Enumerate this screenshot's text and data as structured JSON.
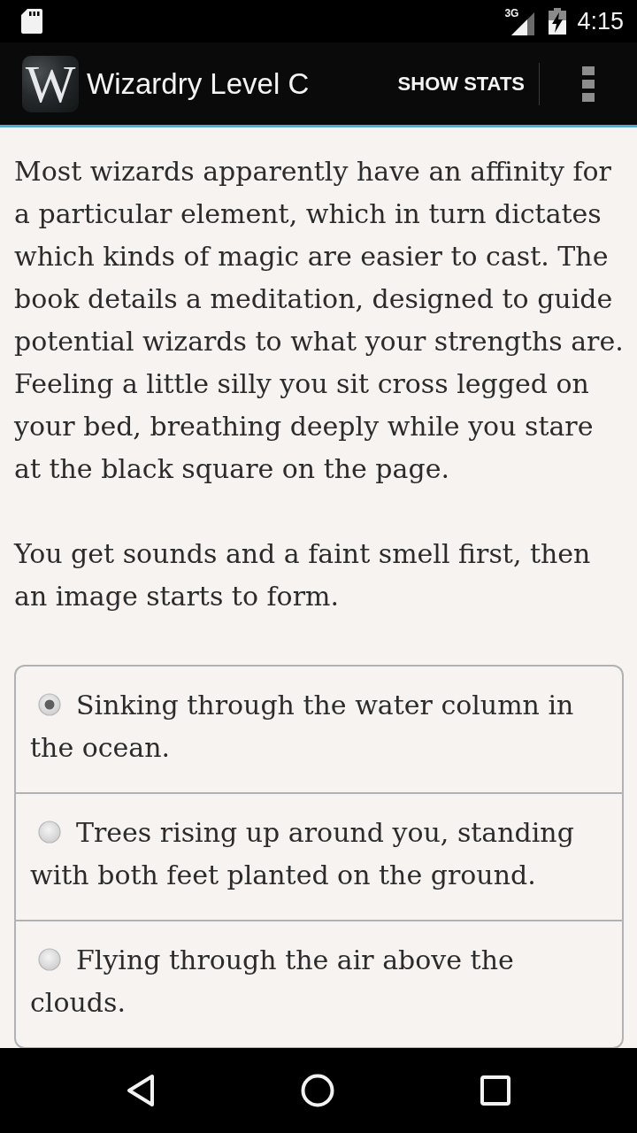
{
  "status_bar": {
    "network": "3G",
    "time": "4:15"
  },
  "app_bar": {
    "logo_letter": "W",
    "title": "Wizardry Level C",
    "actions": [
      {
        "label": "SHOW STATS"
      }
    ]
  },
  "story": {
    "paragraphs": [
      "Most wizards apparently have an affinity for a particular element, which in turn dictates which kinds of magic are easier to cast. The book details a meditation, designed to guide potential wizards to what your strengths are. Feeling a little silly you sit cross legged on your bed, breathing deeply while you stare at the black square on the page.",
      "You get sounds and a faint smell first, then an image starts to form."
    ]
  },
  "choices": [
    {
      "text": "Sinking through the water column in the ocean.",
      "selected": true
    },
    {
      "text": "Trees rising up around you, standing with both feet planted on the ground.",
      "selected": false
    },
    {
      "text": "Flying through the air above the clouds.",
      "selected": false
    }
  ]
}
